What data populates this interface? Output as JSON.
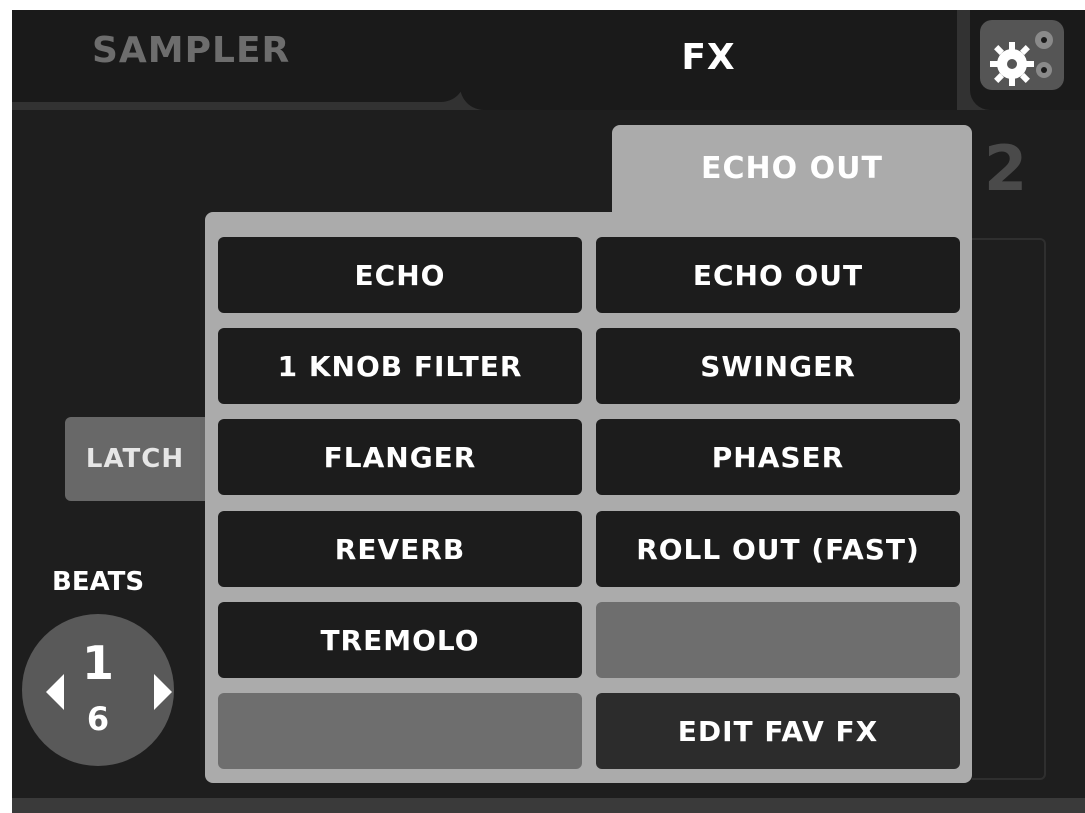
{
  "tabs": {
    "sampler_label": "SAMPLER",
    "fx_label": "FX"
  },
  "settings": {
    "icon": "gears-icon"
  },
  "deck_number": "2",
  "latch_label": "LATCH",
  "beats": {
    "label": "BEATS",
    "numerator": "1",
    "denominator": "6"
  },
  "fx_menu": {
    "selected": "ECHO OUT",
    "items": [
      "ECHO",
      "ECHO OUT",
      "1 KNOB FILTER",
      "SWINGER",
      "FLANGER",
      "PHASER",
      "REVERB",
      "ROLL OUT (FAST)",
      "TREMOLO",
      "",
      "",
      "EDIT FAV FX"
    ]
  },
  "colors": {
    "frame": "#323232",
    "panel": "#1e1e1e",
    "popup": "#ababab",
    "button": "#1c1c1c",
    "empty_button": "#6e6e6e"
  }
}
